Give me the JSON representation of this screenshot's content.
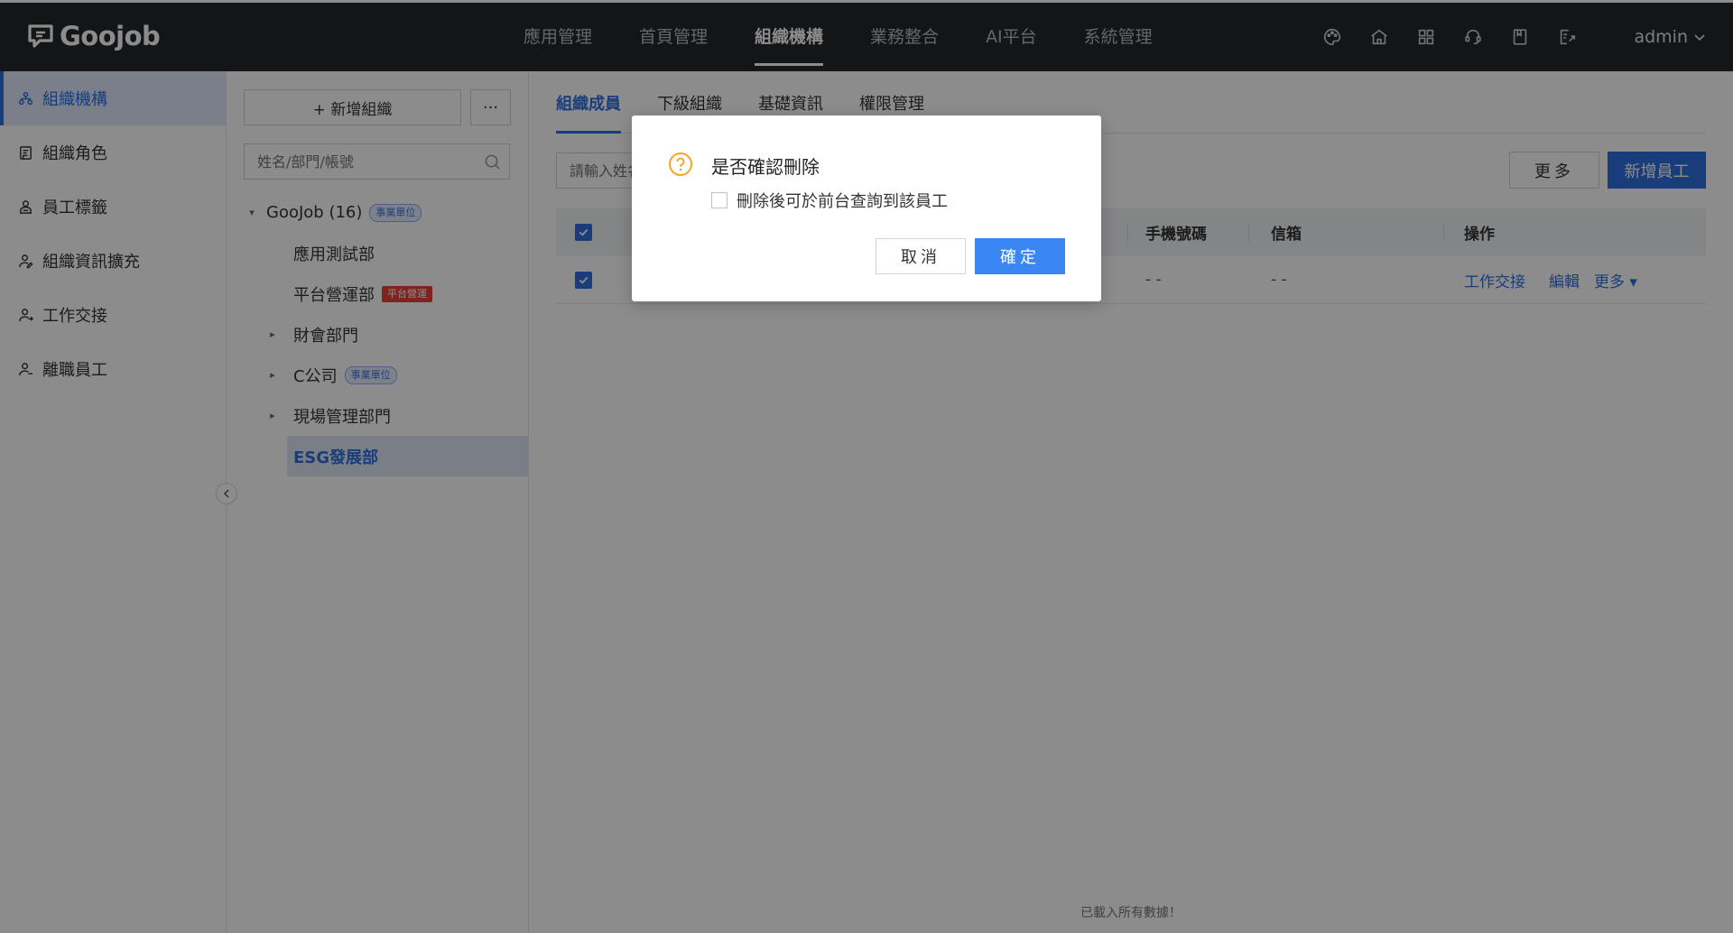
{
  "app": {
    "brand": "Goojob",
    "user": "admin"
  },
  "topnav": [
    {
      "label": "應用管理"
    },
    {
      "label": "首頁管理"
    },
    {
      "label": "組織機構",
      "active": true
    },
    {
      "label": "業務整合"
    },
    {
      "label": "AI平台"
    },
    {
      "label": "系統管理"
    }
  ],
  "topicons": [
    "palette-icon",
    "home-icon",
    "apps-grid-icon",
    "support-icon",
    "bookmark-icon",
    "export-icon"
  ],
  "leftnav": [
    {
      "label": "組織機構",
      "icon": "org-icon",
      "active": true
    },
    {
      "label": "組織角色",
      "icon": "role-icon"
    },
    {
      "label": "員工標籤",
      "icon": "tag-user-icon"
    },
    {
      "label": "組織資訊擴充",
      "icon": "user-edit-icon"
    },
    {
      "label": "工作交接",
      "icon": "user-swap-icon"
    },
    {
      "label": "離職員工",
      "icon": "user-leave-icon"
    }
  ],
  "tree_panel": {
    "add_org_label": "+ 新增組織",
    "more_label": "···",
    "search_placeholder": "姓名/部門/帳號",
    "nodes": [
      {
        "label": "GooJob (16)",
        "tag": "事業單位",
        "tag_color": "blue",
        "expanded": true
      },
      {
        "label": "應用測試部"
      },
      {
        "label": "平台營運部",
        "tag": "平台營運",
        "tag_color": "red"
      },
      {
        "label": "財會部門",
        "collapsed": true
      },
      {
        "label": "C公司",
        "tag": "事業單位",
        "tag_color": "blue",
        "collapsed": true
      },
      {
        "label": "現場管理部門",
        "collapsed": true
      },
      {
        "label": "ESG發展部",
        "selected": true
      }
    ]
  },
  "main": {
    "tabs": [
      {
        "label": "組織成員",
        "active": true
      },
      {
        "label": "下級組織"
      },
      {
        "label": "基礎資訊"
      },
      {
        "label": "權限管理"
      }
    ],
    "search_placeholder": "請輸入姓名",
    "more_button": "更多",
    "new_employee_button": "新增員工",
    "table": {
      "headers": {
        "phone": "手機號碼",
        "email": "信箱",
        "actions": "操作"
      },
      "rows": [
        {
          "phone": "- -",
          "email": "- -",
          "actions": [
            "工作交接",
            "編輯",
            "更多 ▾"
          ]
        }
      ]
    },
    "footer_text": "已載入所有數據！"
  },
  "modal": {
    "title": "是否確認刪除",
    "checkbox_label": "刪除後可於前台查詢到該員工",
    "checkbox_checked": false,
    "cancel_label": "取消",
    "ok_label": "確定"
  },
  "colors": {
    "primary": "#2f6fe0",
    "topbar": "#25272b",
    "ok_button": "#3a86f5",
    "warn_icon": "#f5a623"
  }
}
